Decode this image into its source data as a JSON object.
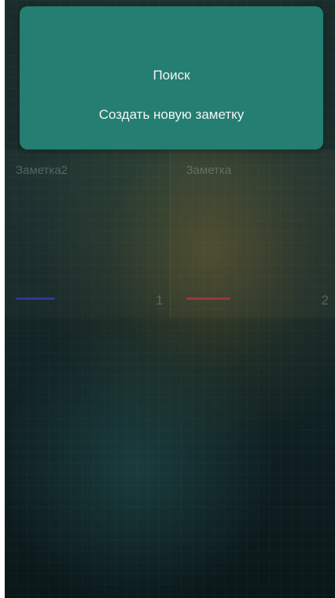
{
  "menu": {
    "items": [
      {
        "label": "Поиск"
      },
      {
        "label": "Создать новую заметку"
      }
    ],
    "color": "#247e72"
  },
  "notes": [
    {
      "title": "Заметка2",
      "number": "1",
      "color": "#2f3fb0"
    },
    {
      "title": "Заметка",
      "number": "2",
      "color": "#b8323a"
    }
  ]
}
